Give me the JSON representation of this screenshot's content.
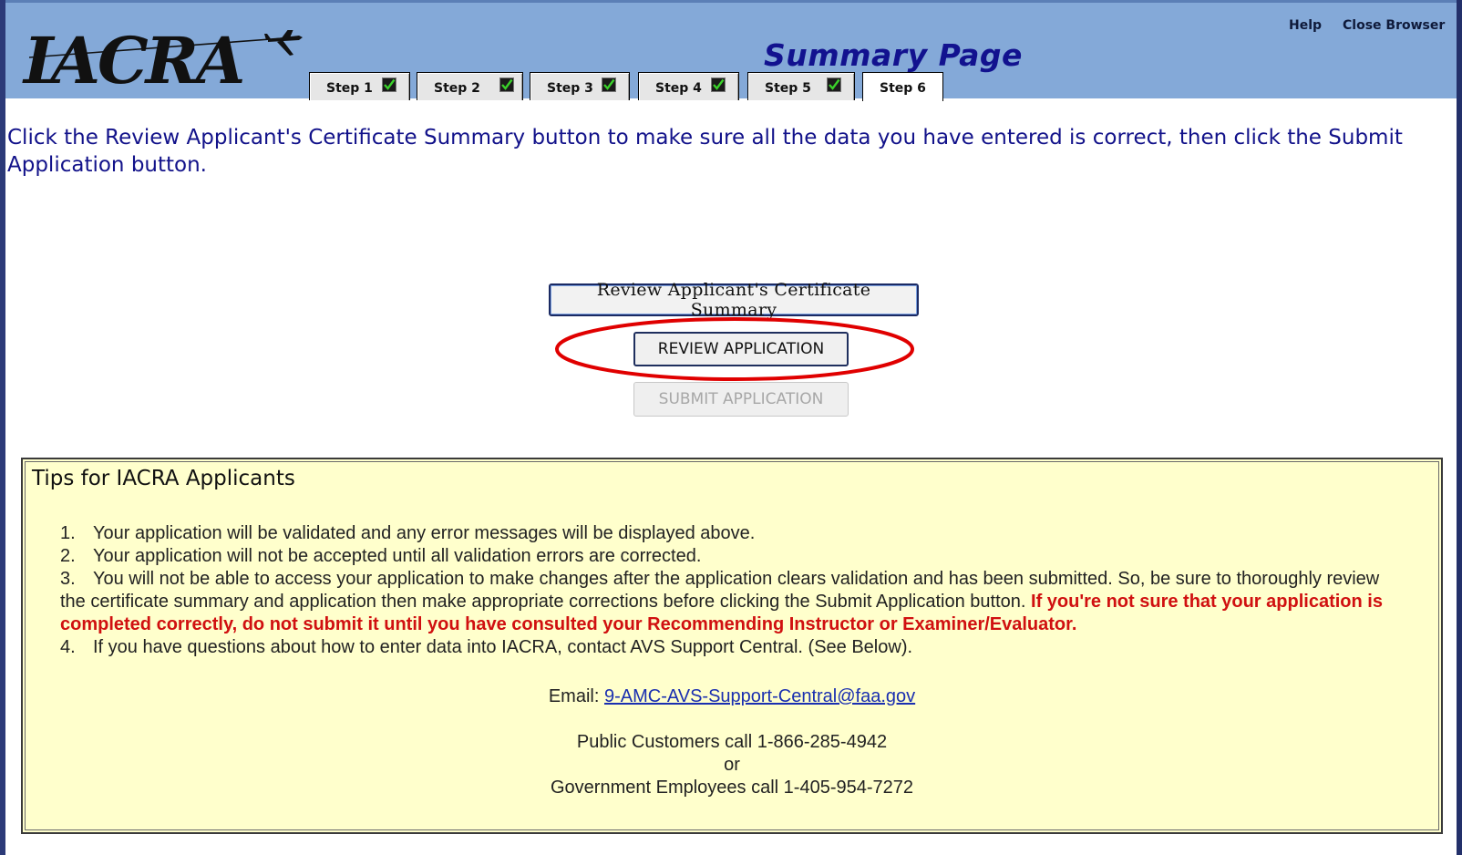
{
  "header": {
    "logo_text": "IACRA",
    "page_title": "Summary Page",
    "links": {
      "help": "Help",
      "close": "Close Browser"
    }
  },
  "tabs": [
    {
      "label": "Step 1",
      "complete": true
    },
    {
      "label": "Step 2",
      "complete": true
    },
    {
      "label": "Step 3",
      "complete": true
    },
    {
      "label": "Step 4",
      "complete": true
    },
    {
      "label": "Step 5",
      "complete": true
    },
    {
      "label": "Step 6",
      "complete": false,
      "active": true
    }
  ],
  "instructions": "Click the Review Applicant's Certificate Summary button to make sure all the data you have entered is correct, then click the Submit Application button.",
  "buttons": {
    "review_summary": "Review Applicant's Certificate Summary",
    "review_application": "REVIEW APPLICATION",
    "submit_application": "SUBMIT APPLICATION"
  },
  "tips": {
    "title": "Tips for IACRA Applicants",
    "items": [
      {
        "num": "1.",
        "text": "Your application will be validated and any error messages will be displayed above."
      },
      {
        "num": "2.",
        "text": "Your application will not be accepted until all validation errors are corrected."
      },
      {
        "num": "3.",
        "text": "You will not be able to access your application to make changes after the application clears validation and has been submitted. So, be sure to thoroughly review the certificate summary and application then make appropriate corrections before clicking the Submit Application button.",
        "warning": "If you're not sure that your application is completed correctly, do not submit it until you have consulted your Recommending Instructor or Examiner/Evaluator."
      },
      {
        "num": "4.",
        "text": "If you have questions about how to enter data into IACRA, contact AVS Support Central. (See Below)."
      }
    ],
    "email_label": "Email:",
    "email": "9-AMC-AVS-Support-Central@faa.gov",
    "phone_public": "Public Customers call 1-866-285-4942",
    "phone_or": "or",
    "phone_gov": "Government Employees call 1-405-954-7272"
  },
  "colors": {
    "header_bg": "#84a9d8",
    "title_color": "#12128f",
    "tips_bg": "#ffffcc",
    "warning": "#d01010",
    "highlight": "#e00000"
  }
}
